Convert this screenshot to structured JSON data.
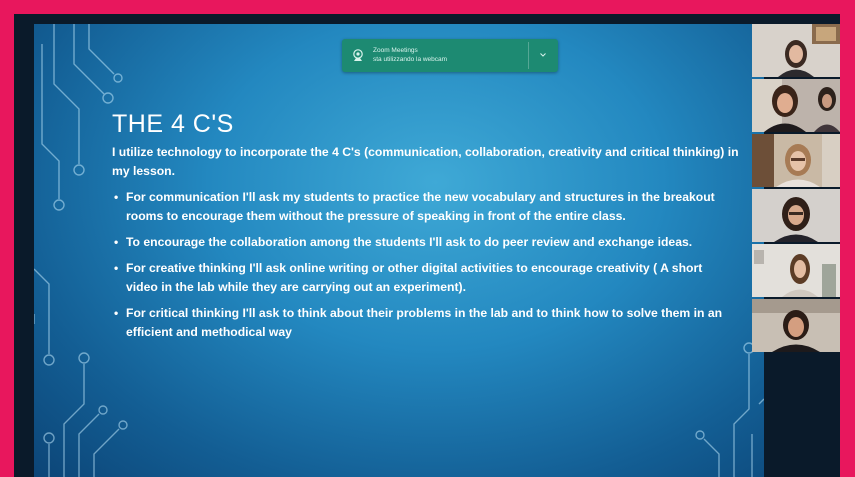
{
  "notification": {
    "title": "Zoom Meetings",
    "subtitle": "sta utilizzando la webcam",
    "icon": "webcam-icon",
    "chevron_icon": "chevron-down-icon"
  },
  "slide": {
    "title": "THE 4 C'S",
    "intro": "I utilize technology to incorporate the 4 C's (communication, collaboration, creativity and critical thinking) in my lesson.",
    "bullet_glyph": "•",
    "bullets": [
      "For communication I'll ask my students to practice the new vocabulary and structures in the breakout rooms to encourage them without the pressure of speaking in front of the entire class.",
      "To encourage the collaboration among the students I'll ask  to do peer review and exchange ideas.",
      "For creative thinking I'll ask online writing or other digital activities to encourage creativity ( A short video in the lab while  they are carrying out an experiment).",
      "For critical thinking I'll ask to think about their problems in the lab and to think how to solve them in an efficient and methodical way"
    ]
  },
  "colors": {
    "frame_border": "#e8175d",
    "slide_background": "#2388c0",
    "notification_background": "#1d8a72",
    "text": "#ffffff"
  },
  "gallery": {
    "participants": [
      {
        "tile": "participant-video-1"
      },
      {
        "tile": "participant-video-2"
      },
      {
        "tile": "participant-video-3"
      },
      {
        "tile": "participant-video-4"
      },
      {
        "tile": "participant-video-5"
      },
      {
        "tile": "participant-video-6"
      }
    ]
  }
}
